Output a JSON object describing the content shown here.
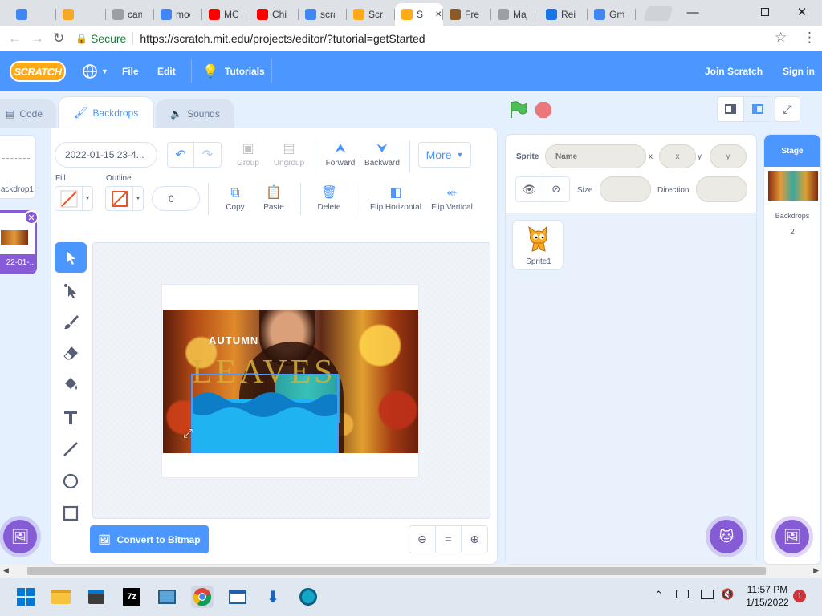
{
  "browser": {
    "tabs": [
      {
        "label": "",
        "color": "#4285f4"
      },
      {
        "label": "",
        "color": "#f9a825"
      },
      {
        "label": "canc",
        "color": "#9aa0a6"
      },
      {
        "label": "moc",
        "color": "#4285f4"
      },
      {
        "label": "MO",
        "color": "#ff0000"
      },
      {
        "label": "Chil",
        "color": "#ff0000"
      },
      {
        "label": "scra",
        "color": "#4285f4"
      },
      {
        "label": "Scra",
        "color": "#ffab19"
      },
      {
        "label": "S",
        "color": "#ffab19"
      },
      {
        "label": "Free",
        "color": "#8b5a2b"
      },
      {
        "label": "Maj",
        "color": "#9aa0a6"
      },
      {
        "label": "Rei",
        "color": "#1a73e8"
      },
      {
        "label": "Gm",
        "color": "#4285f4"
      }
    ],
    "secure_label": "Secure",
    "url": "https://scratch.mit.edu/projects/editor/?tutorial=getStarted"
  },
  "menubar": {
    "logo": "SCRATCH",
    "file": "File",
    "edit": "Edit",
    "tutorials": "Tutorials",
    "join": "Join Scratch",
    "signin": "Sign in"
  },
  "editor_tabs": {
    "code": "Code",
    "backdrops": "Backdrops",
    "sounds": "Sounds"
  },
  "backdrop_list": [
    {
      "label": "ackdrop1"
    },
    {
      "label": "22-01-..."
    }
  ],
  "paint": {
    "costume_name": "2022-01-15 23-4...",
    "group": "Group",
    "ungroup": "Ungroup",
    "forward": "Forward",
    "backward": "Backward",
    "more": "More",
    "fill_label": "Fill",
    "outline_label": "Outline",
    "outline_width": "0",
    "copy": "Copy",
    "paste": "Paste",
    "delete": "Delete",
    "flip_h": "Flip Horizontal",
    "flip_v": "Flip Vertical",
    "convert": "Convert to Bitmap",
    "zoom_reset": "="
  },
  "artwork": {
    "autumn": "AUTUMN",
    "leaves": "LEAVES"
  },
  "sprite_info": {
    "sprite_label": "Sprite",
    "name_placeholder": "Name",
    "x_label": "x",
    "x_placeholder": "x",
    "y_label": "y",
    "y_placeholder": "y",
    "size_label": "Size",
    "direction_label": "Direction"
  },
  "sprites": [
    {
      "name": "Sprite1"
    }
  ],
  "stage": {
    "title": "Stage",
    "backdrops_label": "Backdrops",
    "backdrops_count": "2"
  },
  "taskbar": {
    "time": "11:57 PM",
    "date": "1/15/2022",
    "notifications": "1"
  },
  "colors": {
    "scratch_blue": "#4c97ff",
    "purple": "#855cd6",
    "stage_header": "#4c97ff"
  }
}
